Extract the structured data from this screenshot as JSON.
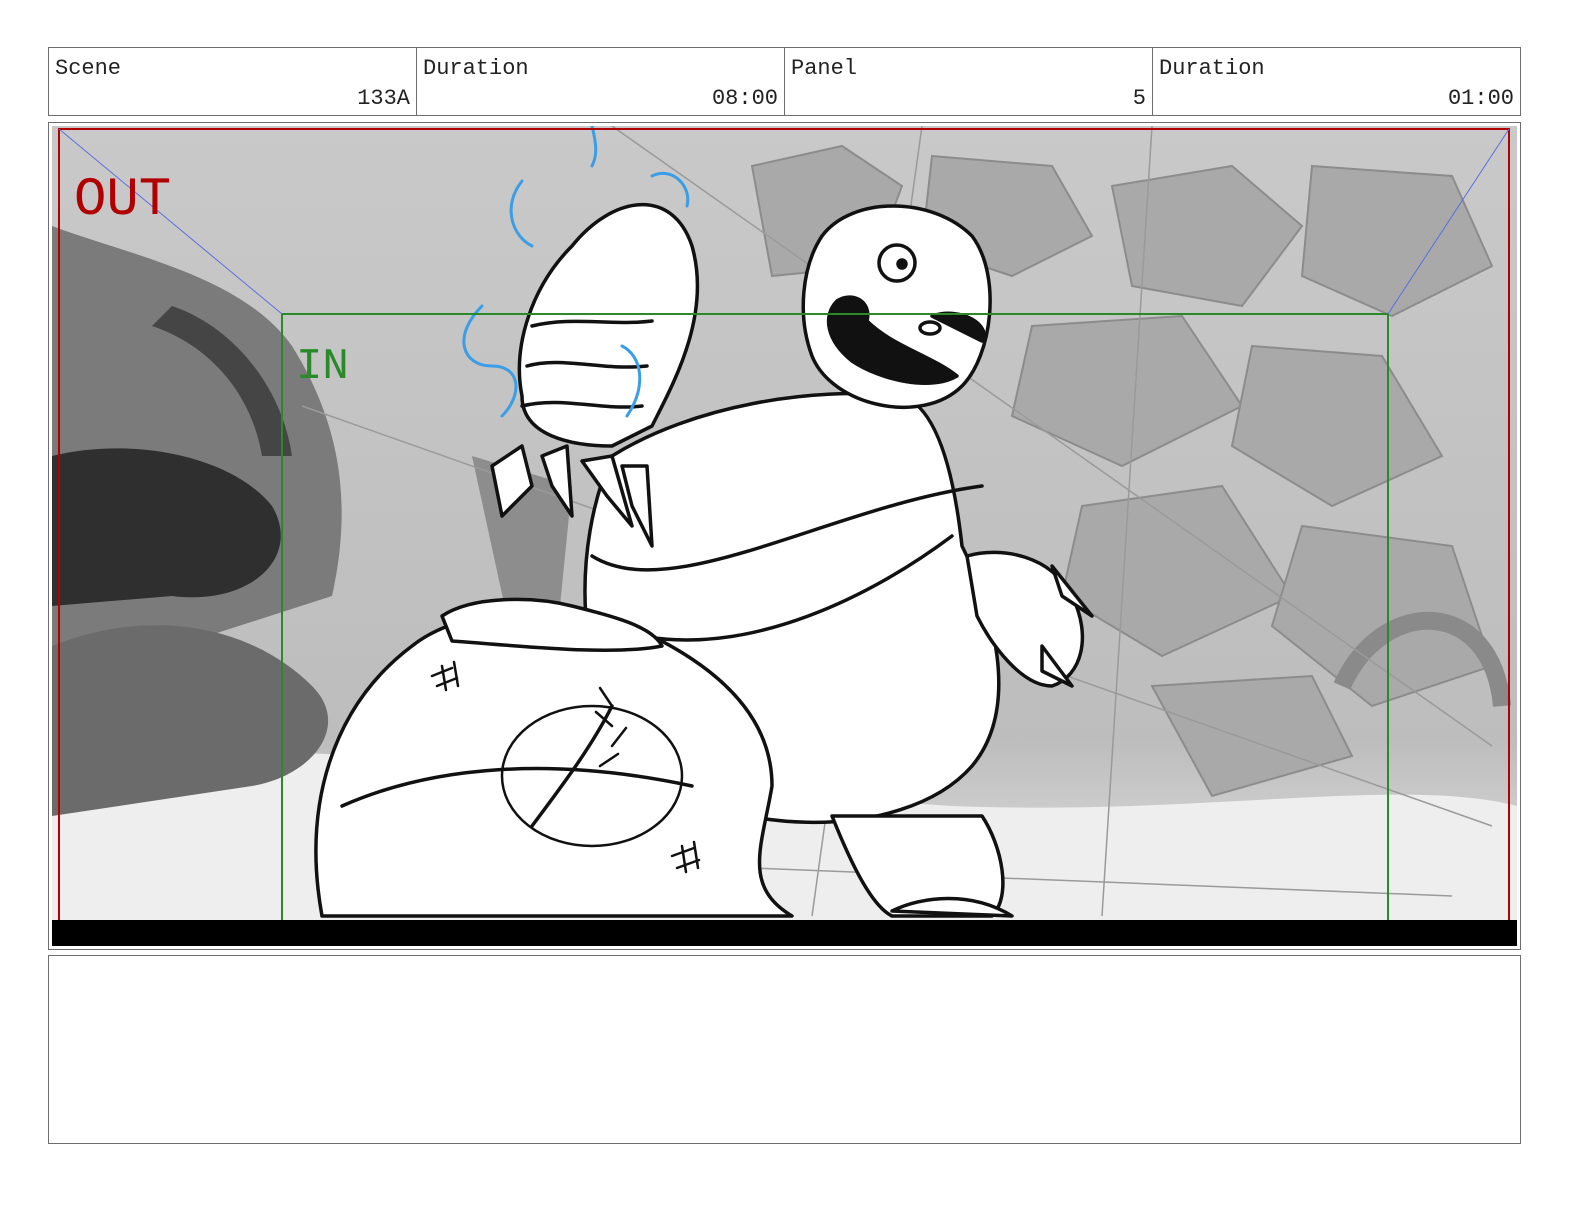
{
  "header": {
    "scene_label": "Scene",
    "scene_value": "133A",
    "scene_duration_label": "Duration",
    "scene_duration_value": "08:00",
    "panel_label": "Panel",
    "panel_value": "5",
    "panel_duration_label": "Duration",
    "panel_duration_value": "01:00"
  },
  "frame": {
    "out_label": "OUT",
    "in_label": "IN",
    "out_color": "#b00000",
    "in_color": "#2a8a2a"
  },
  "notes": {
    "text": ""
  }
}
